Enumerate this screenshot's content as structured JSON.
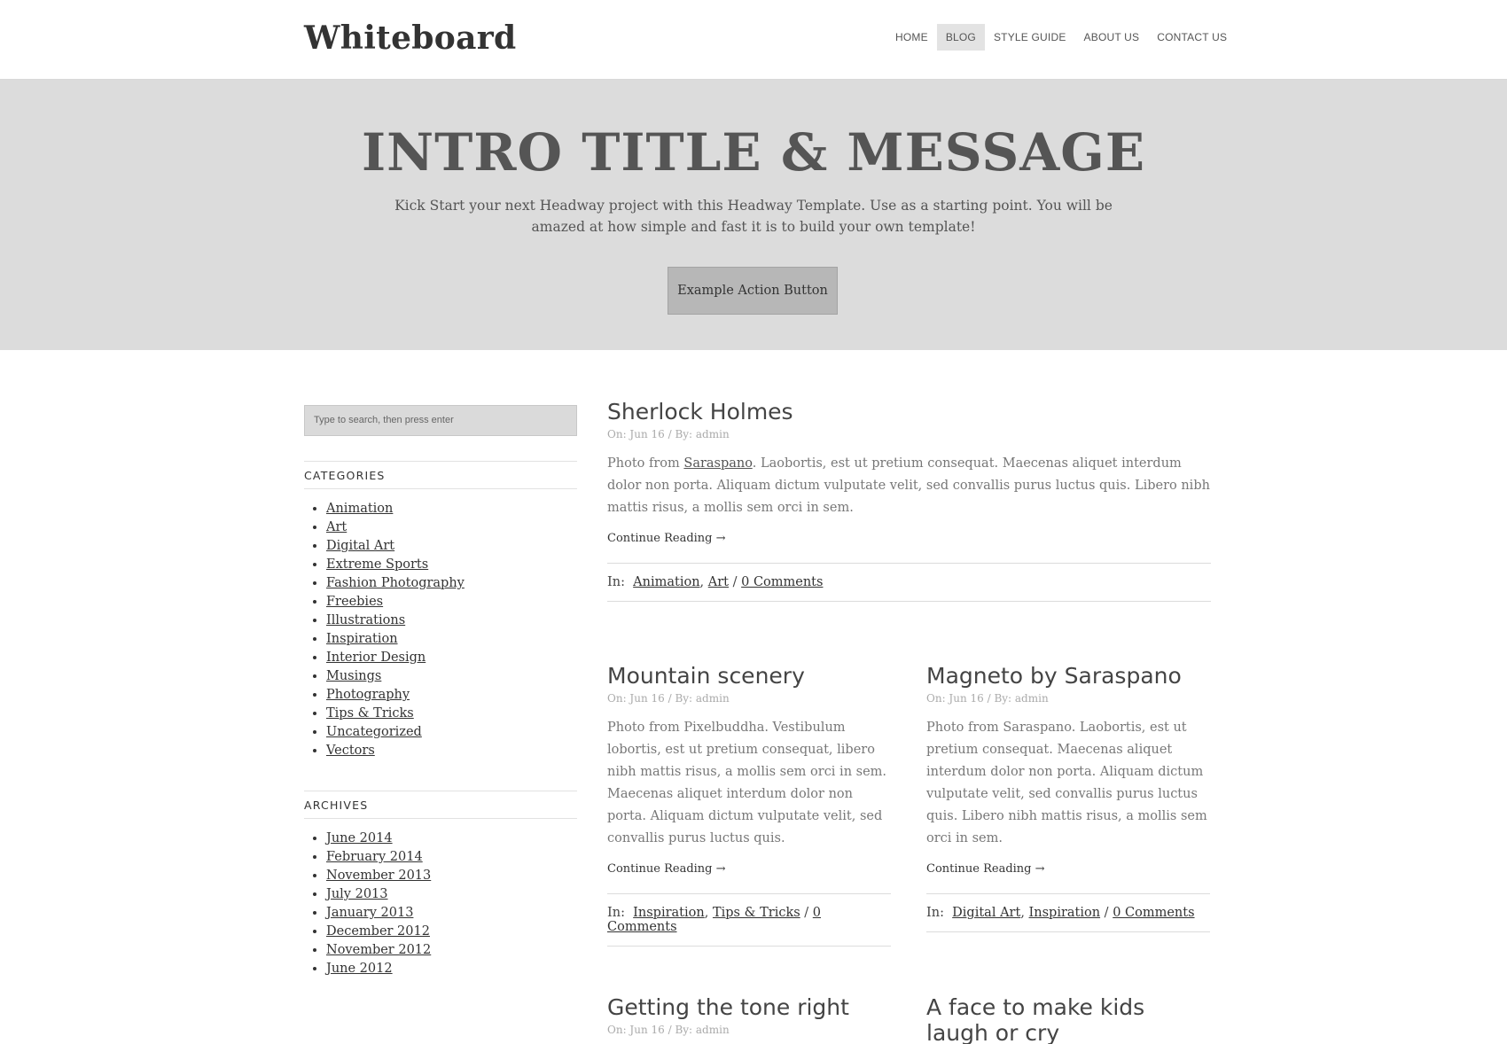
{
  "header": {
    "logo": "Whiteboard",
    "nav": [
      "HOME",
      "BLOG",
      "STYLE GUIDE",
      "ABOUT US",
      "CONTACT US"
    ]
  },
  "hero": {
    "title": "INTRO TITLE & MESSAGE",
    "message": "Kick Start your next Headway project with this Headway Template. Use as a starting point. You will be amazed at how simple and fast it is to build your own template!",
    "button": "Example Action Button"
  },
  "sidebar": {
    "search_placeholder": "Type to search, then press enter",
    "categories_title": "CATEGORIES",
    "categories": [
      "Animation",
      "Art",
      "Digital Art",
      "Extreme Sports",
      "Fashion Photography",
      "Freebies",
      "Illustrations",
      "Inspiration",
      "Interior Design",
      "Musings",
      "Photography",
      "Tips & Tricks",
      "Uncategorized",
      "Vectors"
    ],
    "archives_title": "ARCHIVES",
    "archives": [
      "June 2014",
      "February 2014",
      "November 2013",
      "July 2013",
      "January 2013",
      "December 2012",
      "November 2012",
      "June 2012"
    ]
  },
  "posts": {
    "p1": {
      "title": "Sherlock Holmes",
      "meta": "On: Jun 16 / By: admin",
      "excerpt_pre": "Photo from ",
      "excerpt_link": "Saraspano",
      "excerpt_post": ". Laobortis, est ut pretium consequat. Maecenas aliquet interdum dolor non porta. Aliquam dictum vulputate velit, sed convallis purus luctus quis. Libero nibh mattis risus, a mollis sem orci in sem.",
      "continue": "Continue Reading →",
      "in_label": "In:",
      "cat1": "Animation",
      "cat2": "Art",
      "comments": "0 Comments"
    },
    "p2": {
      "title": "Mountain scenery",
      "meta": "On: Jun 16 / By: admin",
      "excerpt": "Photo from Pixelbuddha. Vestibulum lobortis, est ut pretium consequat, libero nibh mattis risus, a mollis sem orci in sem. Maecenas aliquet interdum dolor non porta. Aliquam dictum vulputate velit, sed convallis purus luctus quis.",
      "continue": "Continue Reading →",
      "in_label": "In:",
      "cat1": "Inspiration",
      "cat2": "Tips & Tricks",
      "comments": "0 Comments"
    },
    "p3": {
      "title": "Magneto by Saraspano",
      "meta": "On: Jun 16 / By: admin",
      "excerpt": "Photo from Saraspano. Laobortis, est ut pretium consequat. Maecenas aliquet interdum dolor non porta. Aliquam dictum vulputate velit, sed convallis purus luctus quis. Libero nibh mattis risus, a mollis sem orci in sem.",
      "continue": "Continue Reading →",
      "in_label": "In:",
      "cat1": "Digital Art",
      "cat2": "Inspiration",
      "comments": "0 Comments"
    },
    "p4": {
      "title": "Getting the tone right",
      "meta": "On: Jun 16 / By: admin"
    },
    "p5": {
      "title": "A face to make kids laugh or cry"
    }
  }
}
